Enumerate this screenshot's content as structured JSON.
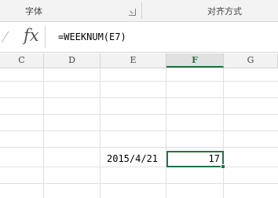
{
  "ribbon": {
    "font_group_label": "字体",
    "alignment_group_label": "对齐方式"
  },
  "formula_bar": {
    "fx_label": "fx",
    "formula": "=WEEKNUM(E7)"
  },
  "columns": [
    {
      "label": "C",
      "active": false
    },
    {
      "label": "D",
      "active": false
    },
    {
      "label": "E",
      "active": false
    },
    {
      "label": "F",
      "active": true
    },
    {
      "label": "G",
      "active": false
    }
  ],
  "cells": {
    "e7": "2015/4/21",
    "f7": "17"
  },
  "colors": {
    "accent": "#217346"
  }
}
